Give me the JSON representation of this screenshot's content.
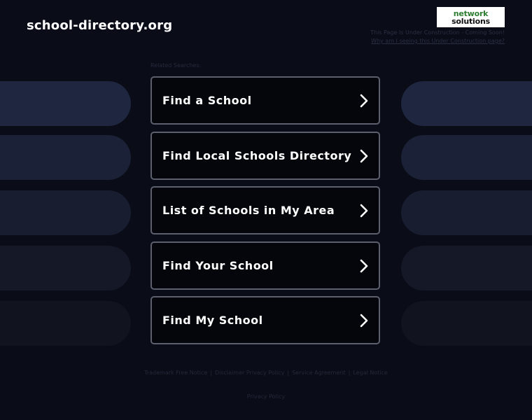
{
  "header": {
    "domain": "school-directory.org",
    "logo": {
      "line1": "network",
      "line2": "solutions",
      "colors": {
        "line1": "#2d7d32",
        "line2": "#111111",
        "background": "#ffffff"
      }
    },
    "notice_line1": "This Page Is Under Construction - Coming Soon!",
    "notice_line2": "Why am I seeing this Under Construction page?"
  },
  "related_heading": "Related Searches:",
  "links": [
    {
      "label": "Find a School"
    },
    {
      "label": "Find Local Schools Directory"
    },
    {
      "label": "List of Schools in My Area"
    },
    {
      "label": "Find Your School"
    },
    {
      "label": "Find My School"
    }
  ],
  "link_icon": "chevron-right-icon",
  "footer": {
    "items": [
      "Trademark Free Notice",
      "Disclaimer Privacy Policy",
      "Service Agreement",
      "Legal Notice"
    ],
    "privacy": "Privacy Policy"
  },
  "colors": {
    "background": "#0a0c17",
    "pill": "#1c2238",
    "box_border": "#5b5f6e",
    "text": "#ffffff"
  }
}
